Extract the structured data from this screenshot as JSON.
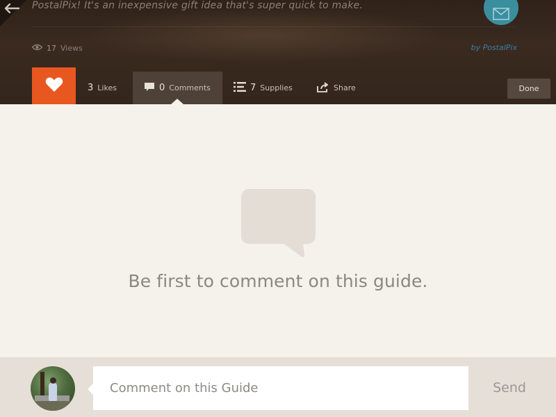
{
  "header": {
    "back_icon": "back-arrow-icon",
    "description": "PostalPix! It's an inexpensive gift idea that's super quick to make.",
    "views_count": "17",
    "views_label": "Views",
    "byline": "by PostalPix",
    "badge_icon": "mail-icon",
    "badge_color": "#3b8e9e"
  },
  "actions": {
    "like_icon": "heart-icon",
    "like_color": "#e8571f",
    "likes_count": "3",
    "likes_label": "Likes",
    "comments_count": "0",
    "comments_label": "Comments",
    "supplies_count": "7",
    "supplies_label": "Supplies",
    "share_label": "Share",
    "done_label": "Done"
  },
  "empty_state": {
    "icon": "comment-bubble-icon",
    "message": "Be first to comment on this guide."
  },
  "compose": {
    "avatar_icon": "user-avatar",
    "placeholder": "Comment on this Guide",
    "value": "",
    "send_label": "Send"
  }
}
